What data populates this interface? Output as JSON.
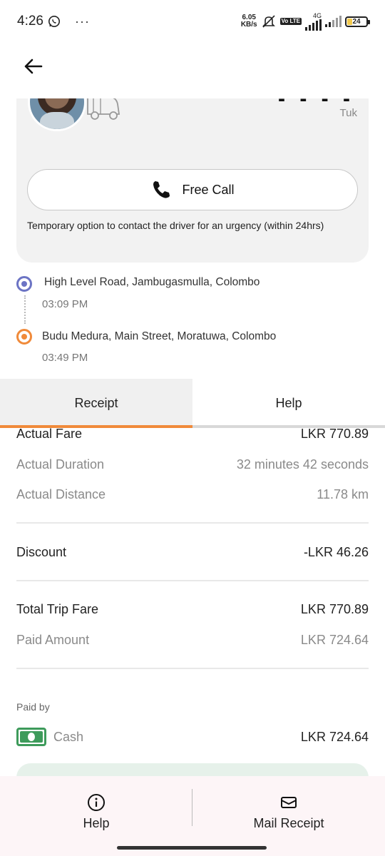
{
  "status_bar": {
    "time": "4:26",
    "net_speed_value": "6.05",
    "net_speed_unit": "KB/s",
    "network_type": "4G",
    "volte_label": "Vo LTE",
    "battery_percent": "24"
  },
  "driver": {
    "vehicle_type": "Tuk",
    "free_call_label": "Free Call",
    "call_note": "Temporary option to contact the driver for an urgency (within 24hrs)"
  },
  "route": {
    "pickup_address": "High Level Road, Jambugasmulla, Colombo",
    "pickup_time": "03:09 PM",
    "dropoff_address": "Budu Medura, Main Street, Moratuwa, Colombo",
    "dropoff_time": "03:49 PM"
  },
  "tabs": [
    {
      "label": "Receipt",
      "active": true
    },
    {
      "label": "Help",
      "active": false
    }
  ],
  "receipt": {
    "actual_fare": {
      "label": "Actual Fare",
      "value": "LKR 770.89"
    },
    "actual_duration": {
      "label": "Actual Duration",
      "value": "32 minutes 42 seconds"
    },
    "actual_distance": {
      "label": "Actual Distance",
      "value": "11.78 km"
    },
    "discount": {
      "label": "Discount",
      "value": "-LKR 46.26"
    },
    "total_trip_fare": {
      "label": "Total Trip Fare",
      "value": "LKR 770.89"
    },
    "paid_amount": {
      "label": "Paid Amount",
      "value": "LKR 724.64"
    },
    "paid_by_label": "Paid by",
    "payment_method": "Cash",
    "payment_amount": "LKR 724.64"
  },
  "bottom_bar": {
    "help_label": "Help",
    "mail_receipt_label": "Mail Receipt"
  },
  "colors": {
    "accent_orange": "#f08a3a",
    "pickup_blue": "#6c74c4",
    "cash_green": "#3e9b5b"
  }
}
